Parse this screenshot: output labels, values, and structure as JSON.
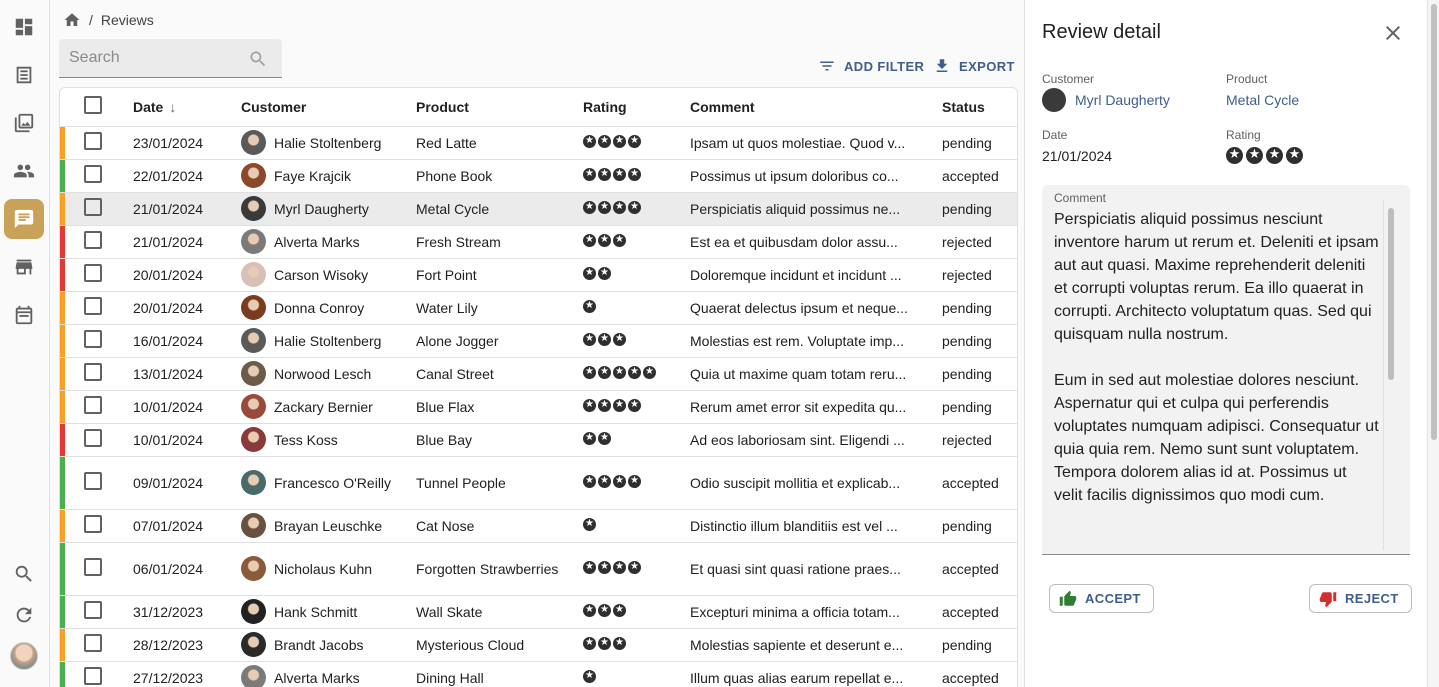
{
  "breadcrumb": {
    "current": "Reviews"
  },
  "search": {
    "placeholder": "Search",
    "value": ""
  },
  "toolbar": {
    "add_filter": "ADD FILTER",
    "export": "EXPORT"
  },
  "table": {
    "columns": [
      "Date",
      "Customer",
      "Product",
      "Rating",
      "Comment",
      "Status"
    ],
    "rows": [
      {
        "date": "23/01/2024",
        "customer": "Halie Stoltenberg",
        "product": "Red Latte",
        "rating": 4,
        "comment": "Ipsam ut quos molestiae. Quod v...",
        "status": "pending",
        "bar": "#f7a226",
        "avatar": "#5a5a5a"
      },
      {
        "date": "22/01/2024",
        "customer": "Faye Krajcik",
        "product": "Phone Book",
        "rating": 4,
        "comment": "Possimus ut ipsum doloribus co...",
        "status": "accepted",
        "bar": "#4caf50",
        "avatar": "#8a4a2a"
      },
      {
        "date": "21/01/2024",
        "customer": "Myrl Daugherty",
        "product": "Metal Cycle",
        "rating": 4,
        "comment": "Perspiciatis aliquid possimus ne...",
        "status": "pending",
        "bar": "#f7a226",
        "avatar": "#3a3a3a",
        "selected": true
      },
      {
        "date": "21/01/2024",
        "customer": "Alverta Marks",
        "product": "Fresh Stream",
        "rating": 3,
        "comment": "Est ea et quibusdam dolor assu...",
        "status": "rejected",
        "bar": "#e53935",
        "avatar": "#7a7a7a"
      },
      {
        "date": "20/01/2024",
        "customer": "Carson Wisoky",
        "product": "Fort Point",
        "rating": 2,
        "comment": "Doloremque incidunt et incidunt ...",
        "status": "rejected",
        "bar": "#e53935",
        "avatar": "#d8c0b8"
      },
      {
        "date": "20/01/2024",
        "customer": "Donna Conroy",
        "product": "Water Lily",
        "rating": 1,
        "comment": "Quaerat delectus ipsum et neque...",
        "status": "pending",
        "bar": "#f7a226",
        "avatar": "#7a3b1f"
      },
      {
        "date": "16/01/2024",
        "customer": "Halie Stoltenberg",
        "product": "Alone Jogger",
        "rating": 3,
        "comment": "Molestias est rem. Voluptate imp...",
        "status": "pending",
        "bar": "#f7a226",
        "avatar": "#5a5a5a"
      },
      {
        "date": "13/01/2024",
        "customer": "Norwood Lesch",
        "product": "Canal Street",
        "rating": 5,
        "comment": "Quia ut maxime quam totam reru...",
        "status": "pending",
        "bar": "#f7a226",
        "avatar": "#6e5a4a"
      },
      {
        "date": "10/01/2024",
        "customer": "Zackary Bernier",
        "product": "Blue Flax",
        "rating": 4,
        "comment": "Rerum amet error sit expedita qu...",
        "status": "pending",
        "bar": "#f7a226",
        "avatar": "#9a4a3a"
      },
      {
        "date": "10/01/2024",
        "customer": "Tess Koss",
        "product": "Blue Bay",
        "rating": 2,
        "comment": "Ad eos laboriosam sint. Eligendi ...",
        "status": "rejected",
        "bar": "#e53935",
        "avatar": "#8a3a3a"
      },
      {
        "date": "09/01/2024",
        "customer": "Francesco O'Reilly",
        "product": "Tunnel People",
        "rating": 4,
        "comment": "Odio suscipit mollitia et explicab...",
        "status": "accepted",
        "bar": "#4caf50",
        "avatar": "#4a6a6a",
        "tall": true
      },
      {
        "date": "07/01/2024",
        "customer": "Brayan Leuschke",
        "product": "Cat Nose",
        "rating": 1,
        "comment": "Distinctio illum blanditiis est vel ...",
        "status": "pending",
        "bar": "#f7a226",
        "avatar": "#6a5040"
      },
      {
        "date": "06/01/2024",
        "customer": "Nicholaus Kuhn",
        "product": "Forgotten Strawberries",
        "rating": 4,
        "comment": "Et quasi sint quasi ratione praes...",
        "status": "accepted",
        "bar": "#4caf50",
        "avatar": "#8a5a3a",
        "tall": true
      },
      {
        "date": "31/12/2023",
        "customer": "Hank Schmitt",
        "product": "Wall Skate",
        "rating": 3,
        "comment": "Excepturi minima a officia totam...",
        "status": "accepted",
        "bar": "#4caf50",
        "avatar": "#222222"
      },
      {
        "date": "28/12/2023",
        "customer": "Brandt Jacobs",
        "product": "Mysterious Cloud",
        "rating": 3,
        "comment": "Molestias sapiente et deserunt e...",
        "status": "pending",
        "bar": "#f7a226",
        "avatar": "#2a2a2a"
      },
      {
        "date": "27/12/2023",
        "customer": "Alverta Marks",
        "product": "Dining Hall",
        "rating": 1,
        "comment": "Illum quas alias earum repellat e...",
        "status": "accepted",
        "bar": "#4caf50",
        "avatar": "#7a7a7a"
      }
    ]
  },
  "detail": {
    "title": "Review detail",
    "customer_label": "Customer",
    "customer": "Myrl Daugherty",
    "product_label": "Product",
    "product": "Metal Cycle",
    "date_label": "Date",
    "date": "21/01/2024",
    "rating_label": "Rating",
    "rating": 4,
    "comment_label": "Comment",
    "comment": "Perspiciatis aliquid possimus nesciunt inventore harum ut rerum et. Deleniti et ipsam aut aut quasi. Maxime reprehenderit deleniti et corrupti voluptas rerum. Ea illo quaerat in corrupti. Architecto voluptatum quas. Sed qui quisquam nulla nostrum.\n\nEum in sed aut molestiae dolores nesciunt. Aspernatur qui et culpa qui perferendis voluptates numquam adipisci. Consequatur ut quia quia rem. Nemo sunt sunt voluptatem. Tempora dolorem alias id at. Possimus ut velit facilis dignissimos quo modi cum.",
    "accept_label": "ACCEPT",
    "reject_label": "REJECT"
  },
  "colors": {
    "accent": "#3f5e8c",
    "active_nav": "#c9a158",
    "pending": "#f7a226",
    "accepted": "#4caf50",
    "rejected": "#e53935"
  },
  "icons": {
    "nav": [
      "dashboard-icon",
      "list-icon",
      "image-icon",
      "people-icon",
      "comment-icon",
      "store-icon",
      "calendar-icon",
      "search-icon",
      "refresh-icon"
    ]
  }
}
